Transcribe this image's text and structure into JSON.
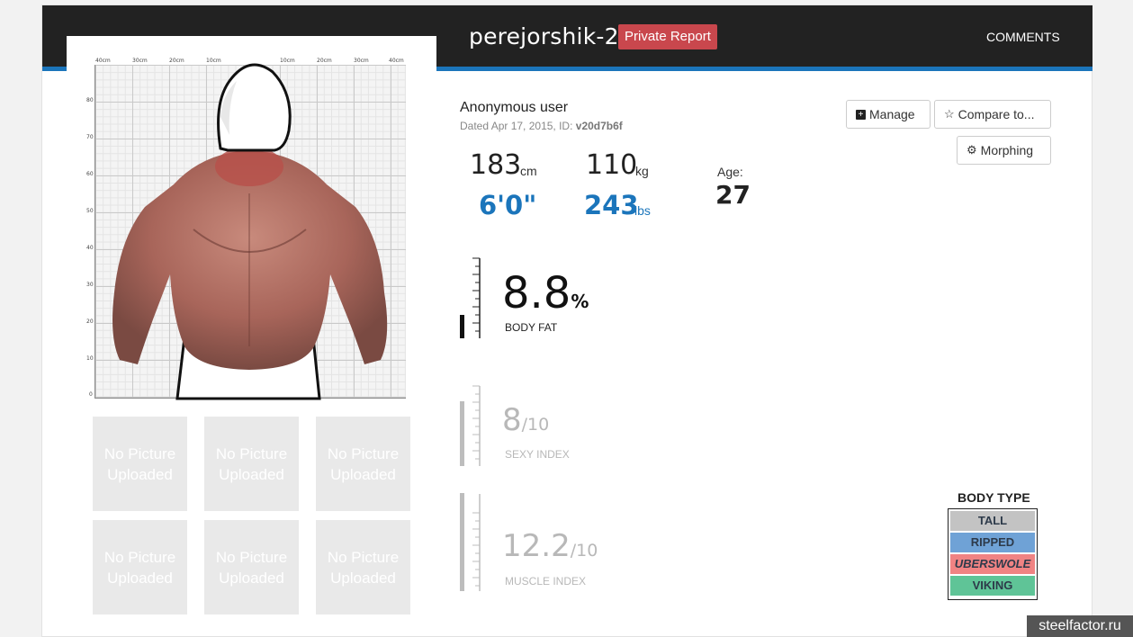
{
  "header": {
    "username": "perejorshik-2",
    "badge": "Private Report",
    "comments": "COMMENTS"
  },
  "photo": {
    "ruler_top": [
      "40cm",
      "30cm",
      "20cm",
      "10cm",
      "10cm",
      "20cm",
      "30cm",
      "40cm"
    ],
    "ruler_left": [
      "80",
      "70",
      "60",
      "50",
      "40",
      "30",
      "20",
      "10",
      "0"
    ],
    "thumbnails": [
      "No Picture Uploaded",
      "No Picture Uploaded",
      "No Picture Uploaded",
      "No Picture Uploaded",
      "No Picture Uploaded",
      "No Picture Uploaded"
    ]
  },
  "user": {
    "name": "Anonymous user",
    "dated_prefix": "Dated Apr 17, 2015, ID:",
    "id": "v20d7b6f"
  },
  "buttons": {
    "manage": "Manage",
    "compare": "Compare to...",
    "morphing": "Morphing"
  },
  "stats": {
    "height_cm": "183",
    "height_cm_unit": "cm",
    "height_ft": "6'0\"",
    "weight_kg": "110",
    "weight_kg_unit": "kg",
    "weight_lbs": "243",
    "weight_lbs_unit": "lbs",
    "age_label": "Age:",
    "age": "27"
  },
  "metrics": {
    "body_fat": {
      "value": "8.8",
      "unit": "%",
      "label": "BODY FAT"
    },
    "sexy_index": {
      "value": "8",
      "unit": "/10",
      "label": "SEXY INDEX"
    },
    "muscle_index": {
      "value": "12.2",
      "unit": "/10",
      "label": "MUSCLE INDEX"
    }
  },
  "body_type": {
    "title": "BODY TYPE",
    "items": [
      {
        "label": "TALL",
        "color": "#c3c3c3"
      },
      {
        "label": "RIPPED",
        "color": "#6fa2d6"
      },
      {
        "label": "UBERSWOLE",
        "color": "#f08383"
      },
      {
        "label": "VIKING",
        "color": "#5fc497"
      }
    ]
  },
  "watermark": "steelfactor.ru",
  "colors": {
    "header_bg": "#222222",
    "accent_blue": "#1b75bb",
    "badge_red": "#c9474d"
  }
}
